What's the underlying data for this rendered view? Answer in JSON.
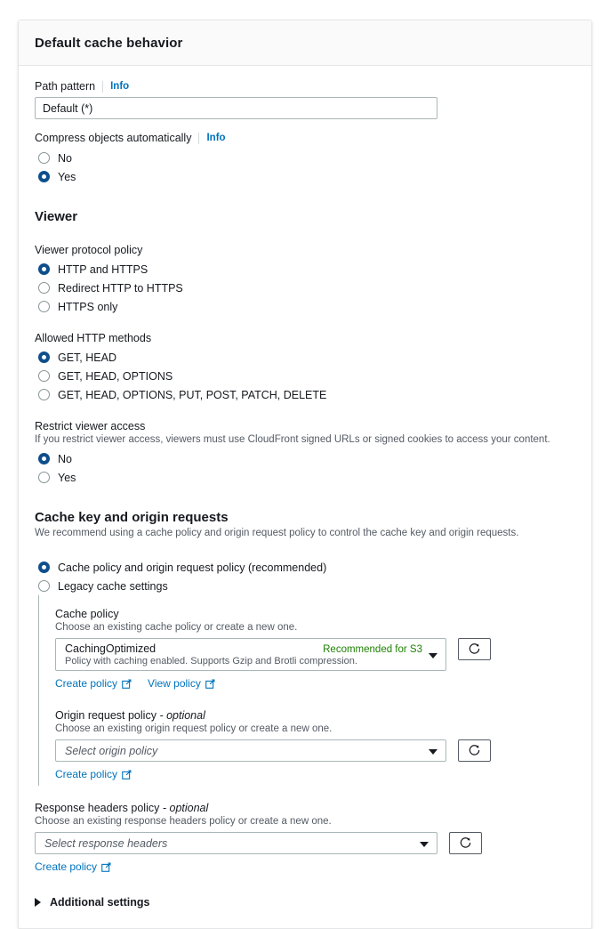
{
  "card": {
    "title": "Default cache behavior"
  },
  "path_pattern": {
    "label": "Path pattern",
    "info": "Info",
    "value": "Default (*)"
  },
  "compress": {
    "label": "Compress objects automatically",
    "info": "Info",
    "options": [
      {
        "label": "No",
        "selected": false
      },
      {
        "label": "Yes",
        "selected": true
      }
    ]
  },
  "viewer": {
    "heading": "Viewer",
    "protocol_policy": {
      "label": "Viewer protocol policy",
      "options": [
        {
          "label": "HTTP and HTTPS",
          "selected": true
        },
        {
          "label": "Redirect HTTP to HTTPS",
          "selected": false
        },
        {
          "label": "HTTPS only",
          "selected": false
        }
      ]
    },
    "allowed_methods": {
      "label": "Allowed HTTP methods",
      "options": [
        {
          "label": "GET, HEAD",
          "selected": true
        },
        {
          "label": "GET, HEAD, OPTIONS",
          "selected": false
        },
        {
          "label": "GET, HEAD, OPTIONS, PUT, POST, PATCH, DELETE",
          "selected": false
        }
      ]
    },
    "restrict_access": {
      "label": "Restrict viewer access",
      "description": "If you restrict viewer access, viewers must use CloudFront signed URLs or signed cookies to access your content.",
      "options": [
        {
          "label": "No",
          "selected": true
        },
        {
          "label": "Yes",
          "selected": false
        }
      ]
    }
  },
  "cache_key": {
    "heading": "Cache key and origin requests",
    "description": "We recommend using a cache policy and origin request policy to control the cache key and origin requests.",
    "options": [
      {
        "label": "Cache policy and origin request policy (recommended)",
        "selected": true
      },
      {
        "label": "Legacy cache settings",
        "selected": false
      }
    ],
    "cache_policy": {
      "label": "Cache policy",
      "hint": "Choose an existing cache policy or create a new one.",
      "selected_title": "CachingOptimized",
      "selected_badge": "Recommended for S3",
      "selected_desc": "Policy with caching enabled. Supports Gzip and Brotli compression.",
      "create_link": "Create policy",
      "view_link": "View policy",
      "refresh_icon": "refresh-icon"
    },
    "origin_request_policy": {
      "label": "Origin request policy",
      "optional": "- optional",
      "hint": "Choose an existing origin request policy or create a new one.",
      "placeholder": "Select origin policy",
      "create_link": "Create policy",
      "refresh_icon": "refresh-icon"
    }
  },
  "response_headers_policy": {
    "label": "Response headers policy",
    "optional": "- optional",
    "hint": "Choose an existing response headers policy or create a new one.",
    "placeholder": "Select response headers",
    "create_link": "Create policy",
    "refresh_icon": "refresh-icon"
  },
  "additional_settings": {
    "label": "Additional settings",
    "expanded": false,
    "icon": "triangle-right-icon"
  },
  "colors": {
    "link_blue": "#0073bb",
    "radio_selected": "#0f4f8b",
    "badge_green": "#1d8102",
    "text": "#16191f",
    "muted": "#545b64",
    "border": "#aab7b8"
  }
}
